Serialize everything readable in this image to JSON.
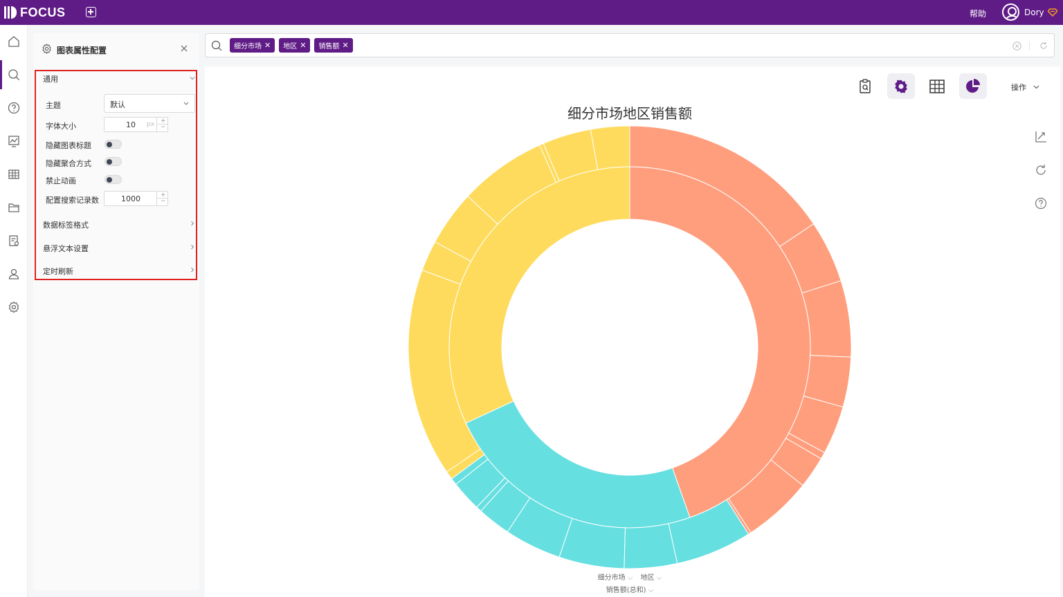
{
  "app": {
    "logo_text": "FOCUS",
    "help_label": "帮助",
    "user_name": "Dory"
  },
  "rail": {
    "items": [
      {
        "name": "home-icon"
      },
      {
        "name": "search-icon"
      },
      {
        "name": "help-icon"
      },
      {
        "name": "dashboard-icon"
      },
      {
        "name": "table-icon"
      },
      {
        "name": "folder-icon"
      },
      {
        "name": "report-settings-icon"
      },
      {
        "name": "user-icon"
      },
      {
        "name": "settings-icon"
      }
    ],
    "active_index": 1
  },
  "config_panel": {
    "title": "图表属性配置",
    "general_section": "通用",
    "theme_label": "主题",
    "theme_value": "默认",
    "font_size_label": "字体大小",
    "font_size_value": "10",
    "font_size_unit": "px",
    "hide_title_label": "隐藏图表标题",
    "hide_title_on": false,
    "hide_agg_label": "隐藏聚合方式",
    "hide_agg_on": false,
    "disable_anim_label": "禁止动画",
    "disable_anim_on": false,
    "search_records_label": "配置搜索记录数",
    "search_records_value": "1000",
    "data_label_format": "数据标签格式",
    "hover_text_settings": "悬浮文本设置",
    "timed_refresh": "定时刷新"
  },
  "search": {
    "chips": [
      {
        "label": "细分市场"
      },
      {
        "label": "地区"
      },
      {
        "label": "销售额"
      }
    ]
  },
  "toolbar": {
    "ops_label": "操作"
  },
  "colors": {
    "brand": "#5f1b86",
    "salmon": "#ff9e7d",
    "cyan": "#66dfe1",
    "yellow": "#fedb5c",
    "highlight": "#e02020"
  },
  "chart_data": {
    "type": "sunburst",
    "title": "细分市场地区销售额",
    "inner_ring": [
      {
        "color": "#ff9e7d",
        "value": 44.6
      },
      {
        "color": "#66dfe1",
        "value": 23.5
      },
      {
        "color": "#fedb5c",
        "value": 31.9
      }
    ],
    "outer_ring": [
      {
        "color": "#ff9e7d",
        "value": 15.4
      },
      {
        "color": "#ff9e7d",
        "value": 4.5
      },
      {
        "color": "#ff9e7d",
        "value": 5.5
      },
      {
        "color": "#ff9e7d",
        "value": 3.6
      },
      {
        "color": "#ff9e7d",
        "value": 3.5
      },
      {
        "color": "#ff9e7d",
        "value": 0.5
      },
      {
        "color": "#ff9e7d",
        "value": 2.3
      },
      {
        "color": "#ff9e7d",
        "value": 5.0
      },
      {
        "color": "#ff9e7d",
        "value": 0.2
      },
      {
        "color": "#66dfe1",
        "value": 5.5
      },
      {
        "color": "#66dfe1",
        "value": 3.8
      },
      {
        "color": "#66dfe1",
        "value": 4.7
      },
      {
        "color": "#66dfe1",
        "value": 4.1
      },
      {
        "color": "#66dfe1",
        "value": 2.4
      },
      {
        "color": "#66dfe1",
        "value": 0.4
      },
      {
        "color": "#66dfe1",
        "value": 2.2
      },
      {
        "color": "#66dfe1",
        "value": 0.5
      },
      {
        "color": "#fedb5c",
        "value": 0.6
      },
      {
        "color": "#fedb5c",
        "value": 15.0
      },
      {
        "color": "#fedb5c",
        "value": 2.2
      },
      {
        "color": "#fedb5c",
        "value": 4.0
      },
      {
        "color": "#fedb5c",
        "value": 6.3
      },
      {
        "color": "#fedb5c",
        "value": 0.3
      },
      {
        "color": "#fedb5c",
        "value": 3.5
      },
      {
        "color": "#fedb5c",
        "value": 2.8
      }
    ],
    "legend": {
      "dim1": "细分市场",
      "dim2": "地区",
      "measure": "销售额(总和)"
    }
  }
}
